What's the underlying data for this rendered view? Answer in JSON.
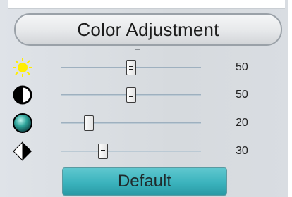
{
  "panel": {
    "title": "Color Adjustment",
    "default_label": "Default"
  },
  "sliders": [
    {
      "name": "brightness",
      "icon": "sun-icon",
      "value": "50",
      "level": 50
    },
    {
      "name": "contrast",
      "icon": "contrast-icon",
      "value": "50",
      "level": 50
    },
    {
      "name": "saturation",
      "icon": "saturation-icon",
      "value": "20",
      "level": 20
    },
    {
      "name": "sharpness",
      "icon": "sharpness-icon",
      "value": "30",
      "level": 30
    }
  ],
  "colors": {
    "sun": "#ffee00",
    "accent": "#3bb3bd"
  }
}
